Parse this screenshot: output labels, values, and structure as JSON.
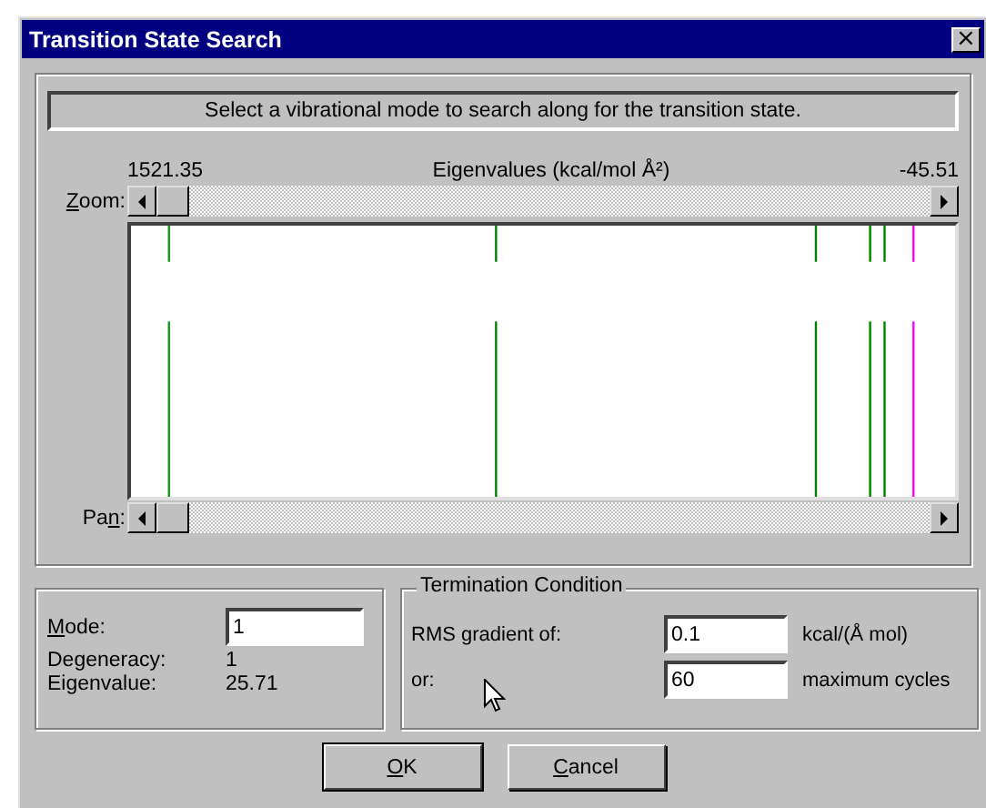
{
  "window": {
    "title": "Transition State Search",
    "close": "×"
  },
  "instruction": "Select a vibrational mode to search along for the transition state.",
  "eigenvalues": {
    "left_value": "1521.35",
    "title": "Eigenvalues (kcal/mol Å²)",
    "right_value": "-45.51"
  },
  "zoom": {
    "label": [
      {
        "text": "Z",
        "underlined": true
      },
      {
        "text": "oom:",
        "underlined": false
      }
    ]
  },
  "pan": {
    "label": [
      {
        "text": "Pa",
        "underlined": false
      },
      {
        "text": "n",
        "underlined": true
      },
      {
        "text": ":",
        "underlined": false
      }
    ]
  },
  "mode_info": {
    "mode_label": [
      {
        "text": "M",
        "underlined": true
      },
      {
        "text": "ode:",
        "underlined": false
      }
    ],
    "mode_value": "1",
    "degeneracy_label": "Degeneracy:",
    "degeneracy": "1",
    "eigenvalue_label": "Eigenvalue:",
    "eigenvalue": "25.71"
  },
  "termination": {
    "title": "Termination Condition",
    "rows": [
      {
        "label": "RMS gradient of:",
        "value": "0.1",
        "unit": "kcal/(Å mol)"
      },
      {
        "label": "or:",
        "value": "60",
        "unit": "maximum cycles"
      }
    ]
  },
  "buttons": [
    {
      "label": [
        {
          "text": "O",
          "underlined": true
        },
        {
          "text": "K",
          "underlined": false
        }
      ],
      "default": true
    },
    {
      "label": [
        {
          "text": "C",
          "underlined": true
        },
        {
          "text": "ancel",
          "underlined": false
        }
      ],
      "default": false
    }
  ]
}
